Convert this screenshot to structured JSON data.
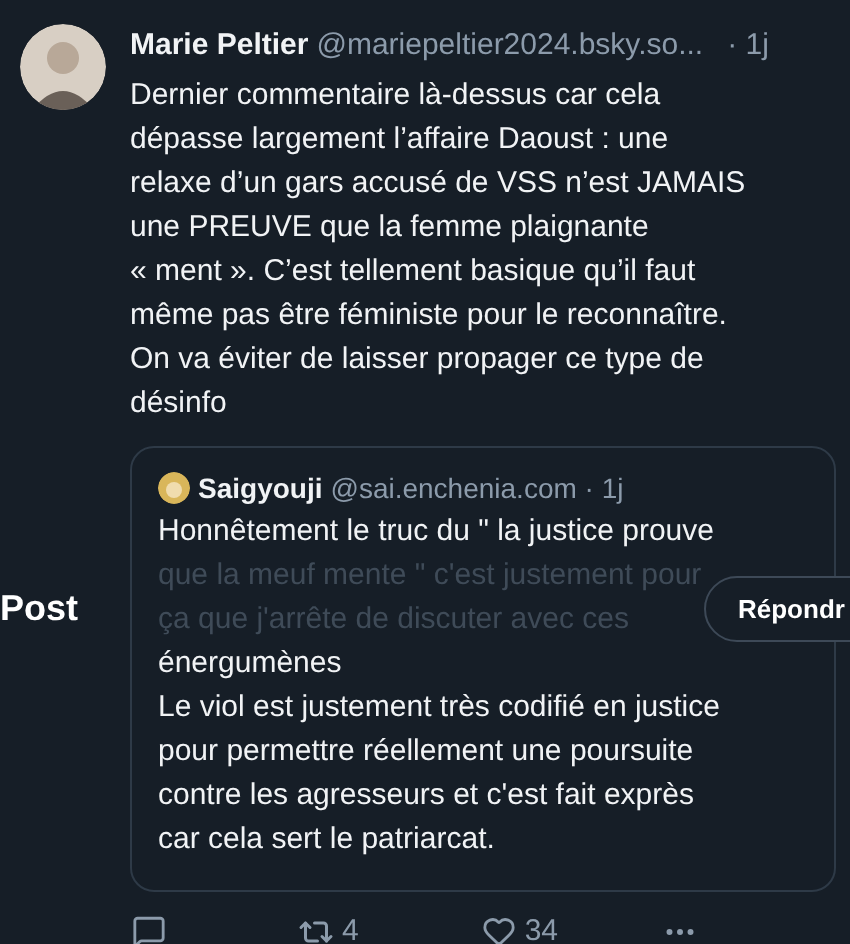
{
  "post": {
    "author": "Marie Peltier",
    "handle": "@mariepeltier2024.bsky.so...",
    "time": "· 1j",
    "body_lines": [
      "Dernier commentaire là-dessus car cela",
      "dépasse largement l’affaire Daoust : une",
      "relaxe d’un gars accusé de VSS n’est JAMAIS",
      "une PREUVE que la femme plaignante",
      "« ment ». C’est tellement basique qu’il faut",
      "même pas être féministe pour le reconnaître.",
      "On va éviter de laisser propager ce type de",
      "désinfo"
    ]
  },
  "quote": {
    "author": "Saigyouji",
    "handle": "@sai.enchenia.com · 1j",
    "segments": [
      {
        "dimmed": false,
        "lines": [
          "Honnêtement le truc du \" la justice prouve"
        ]
      },
      {
        "dimmed": true,
        "lines": [
          "que la meuf mente \" c'est justement pour",
          "ça que j'arrête de discuter avec ces"
        ]
      },
      {
        "dimmed": false,
        "lines": [
          "énergumènes",
          "Le viol est justement très codifié en justice",
          "pour permettre réellement une poursuite",
          "contre les agresseurs et c'est fait exprès",
          "car cela sert le patriarcat."
        ]
      }
    ]
  },
  "overlay": {
    "label": "Post",
    "button": "Répondr"
  },
  "actions": {
    "reposts": "4",
    "likes": "34"
  }
}
